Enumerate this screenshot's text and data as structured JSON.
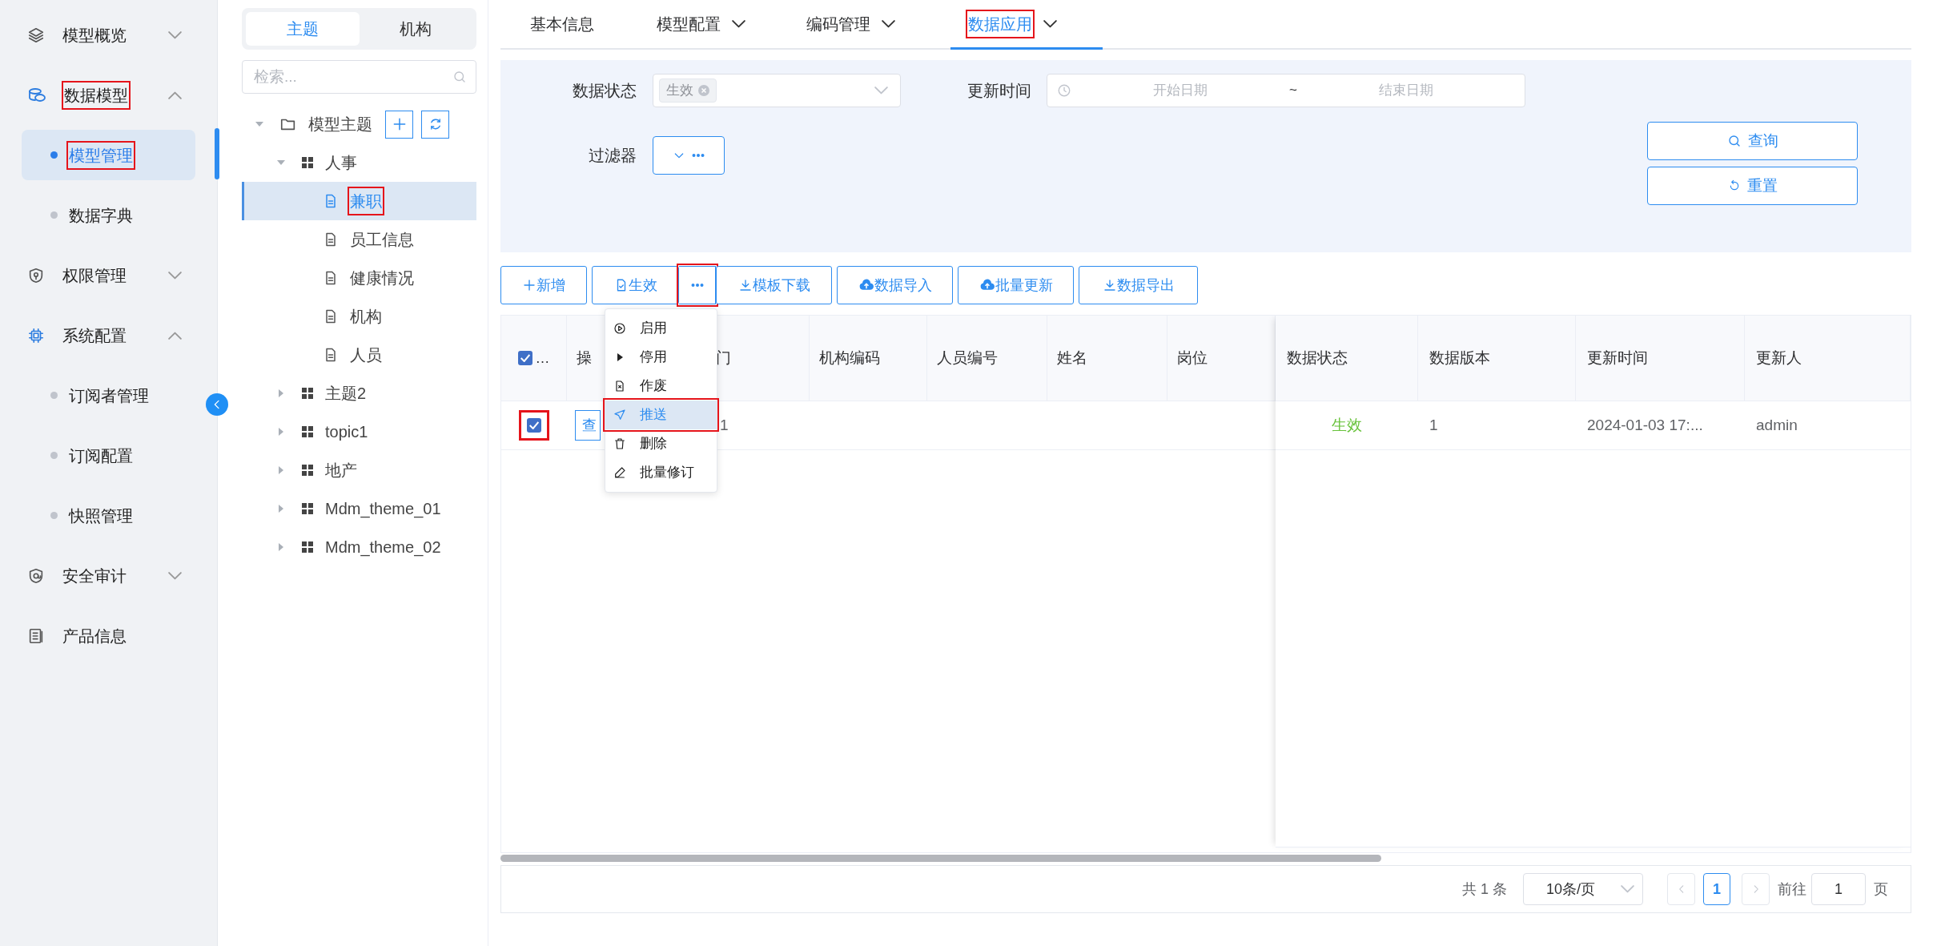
{
  "sidebar": {
    "items": [
      {
        "label": "模型概览",
        "kind": "group",
        "expanded": false,
        "annotated": false
      },
      {
        "label": "数据模型",
        "kind": "group",
        "expanded": true,
        "annotated": true,
        "children": [
          {
            "label": "模型管理",
            "selected": true,
            "annotated": true
          },
          {
            "label": "数据字典",
            "selected": false,
            "annotated": false
          }
        ]
      },
      {
        "label": "权限管理",
        "kind": "group",
        "expanded": false,
        "annotated": false
      },
      {
        "label": "系统配置",
        "kind": "group",
        "expanded": true,
        "annotated": false,
        "children": [
          {
            "label": "订阅者管理",
            "selected": false,
            "annotated": false
          },
          {
            "label": "订阅配置",
            "selected": false,
            "annotated": false
          },
          {
            "label": "快照管理",
            "selected": false,
            "annotated": false
          }
        ]
      },
      {
        "label": "安全审计",
        "kind": "group",
        "expanded": false,
        "annotated": false
      },
      {
        "label": "产品信息",
        "kind": "link",
        "annotated": false
      }
    ]
  },
  "tree": {
    "tabs": [
      {
        "label": "主题",
        "selected": true
      },
      {
        "label": "机构",
        "selected": false
      }
    ],
    "search": {
      "placeholder": "检索..."
    },
    "nodes": [
      {
        "label": "模型主题",
        "expanded": true,
        "selected": false,
        "annotated": false,
        "children": [
          {
            "label": "人事",
            "expanded": true,
            "selected": false,
            "annotated": false,
            "children": [
              {
                "label": "兼职",
                "selected": true,
                "annotated": true
              },
              {
                "label": "员工信息",
                "selected": false,
                "annotated": false
              },
              {
                "label": "健康情况",
                "selected": false,
                "annotated": false
              },
              {
                "label": "机构",
                "selected": false,
                "annotated": false
              },
              {
                "label": "人员",
                "selected": false,
                "annotated": false
              }
            ]
          },
          {
            "label": "主题2",
            "expanded": false,
            "selected": false,
            "annotated": false
          },
          {
            "label": "topic1",
            "expanded": false,
            "selected": false,
            "annotated": false
          },
          {
            "label": "地产",
            "expanded": false,
            "selected": false,
            "annotated": false
          },
          {
            "label": "Mdm_theme_01",
            "expanded": false,
            "selected": false,
            "annotated": false
          },
          {
            "label": "Mdm_theme_02",
            "expanded": false,
            "selected": false,
            "annotated": false
          }
        ]
      }
    ]
  },
  "tabs": [
    {
      "label": "基本信息",
      "dropdown": false,
      "selected": false,
      "annotated": false
    },
    {
      "label": "模型配置",
      "dropdown": true,
      "selected": false,
      "annotated": false
    },
    {
      "label": "编码管理",
      "dropdown": true,
      "selected": false,
      "annotated": false
    },
    {
      "label": "数据应用",
      "dropdown": true,
      "selected": true,
      "annotated": true
    }
  ],
  "filters": {
    "status_label": "数据状态",
    "status_tag": "生效",
    "time_label": "更新时间",
    "start_placeholder": "开始日期",
    "range_separator": "~",
    "end_placeholder": "结束日期",
    "filter_label": "过滤器",
    "query_button": "查询",
    "reset_button": "重置"
  },
  "toolbar": [
    {
      "kind": "button",
      "label": "新增",
      "annotated": false
    },
    {
      "kind": "button",
      "label": "生效",
      "annotated": false
    },
    {
      "kind": "more",
      "annotated": true
    },
    {
      "kind": "button",
      "label": "模板下载",
      "annotated": false
    },
    {
      "kind": "button",
      "label": "数据导入",
      "annotated": false
    },
    {
      "kind": "button",
      "label": "批量更新",
      "annotated": false
    },
    {
      "kind": "button",
      "label": "数据导出",
      "annotated": false
    }
  ],
  "more_menu": [
    {
      "label": "启用",
      "selected": false,
      "annotated": false
    },
    {
      "label": "停用",
      "selected": false,
      "annotated": false
    },
    {
      "label": "作废",
      "selected": false,
      "annotated": false
    },
    {
      "label": "推送",
      "selected": true,
      "annotated": true
    },
    {
      "label": "删除",
      "selected": false,
      "annotated": false
    },
    {
      "label": "批量修订",
      "selected": false,
      "annotated": false
    }
  ],
  "table": {
    "select_all": {
      "checked": true,
      "text": "…"
    },
    "columns": [
      "操",
      "门",
      "机构编码",
      "人员编号",
      "姓名",
      "岗位"
    ],
    "fixed_right_columns": [
      "数据状态",
      "数据版本",
      "更新时间",
      "更新人"
    ],
    "rows": [
      {
        "checked": true,
        "annotated": true,
        "action": "查",
        "dept": "1",
        "status": "生效",
        "version": "1",
        "updated_at": "2024-01-03 17:...",
        "updated_by": "admin"
      }
    ]
  },
  "pagination": {
    "total": "共 1 条",
    "page_size": "10条/页",
    "pages": [
      {
        "label": "1",
        "selected": true
      }
    ],
    "goto_label": "前往",
    "goto_value": "1",
    "page_unit": "页"
  }
}
